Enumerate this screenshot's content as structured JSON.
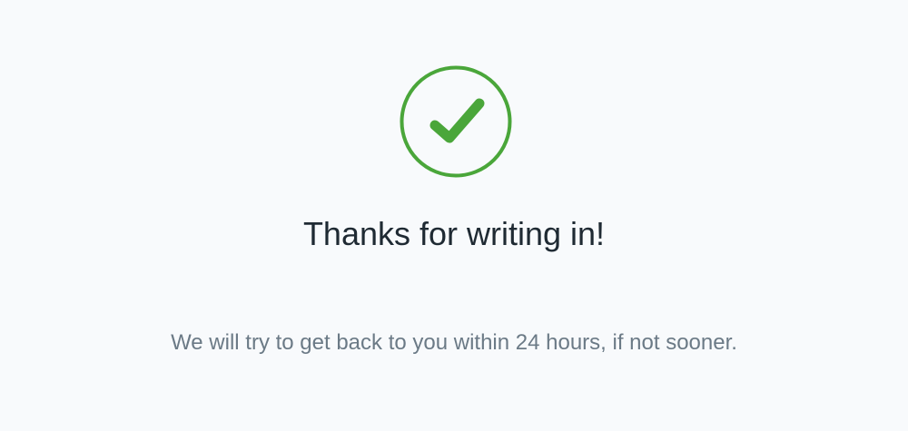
{
  "confirmation": {
    "icon": "check-circle-icon",
    "accent_color": "#4aa63a",
    "title": "Thanks for writing in!",
    "message": "We will try to get back to you within 24 hours, if not sooner."
  }
}
